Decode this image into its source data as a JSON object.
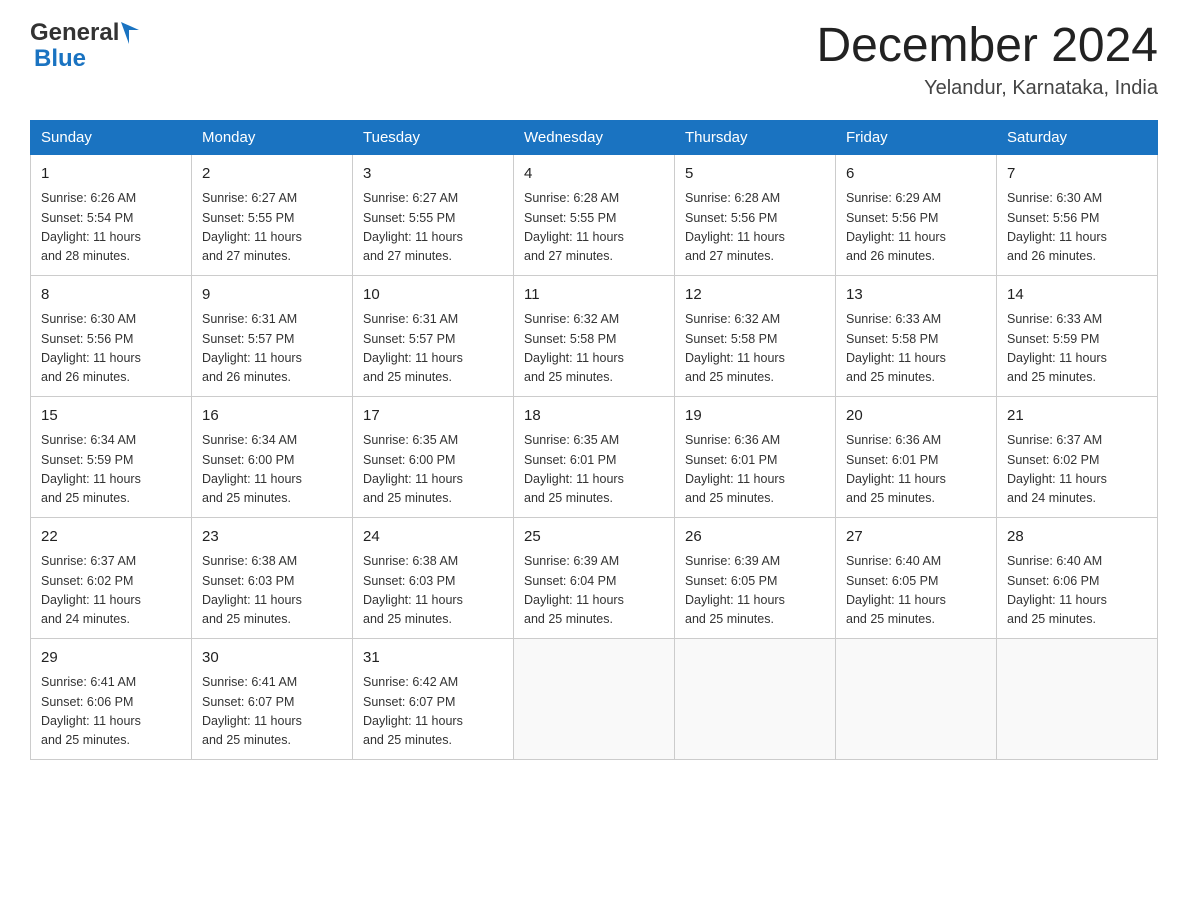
{
  "header": {
    "logo_general": "General",
    "logo_blue": "Blue",
    "title": "December 2024",
    "location": "Yelandur, Karnataka, India"
  },
  "days_of_week": [
    "Sunday",
    "Monday",
    "Tuesday",
    "Wednesday",
    "Thursday",
    "Friday",
    "Saturday"
  ],
  "weeks": [
    [
      {
        "day": "1",
        "sunrise": "6:26 AM",
        "sunset": "5:54 PM",
        "daylight": "11 hours and 28 minutes."
      },
      {
        "day": "2",
        "sunrise": "6:27 AM",
        "sunset": "5:55 PM",
        "daylight": "11 hours and 27 minutes."
      },
      {
        "day": "3",
        "sunrise": "6:27 AM",
        "sunset": "5:55 PM",
        "daylight": "11 hours and 27 minutes."
      },
      {
        "day": "4",
        "sunrise": "6:28 AM",
        "sunset": "5:55 PM",
        "daylight": "11 hours and 27 minutes."
      },
      {
        "day": "5",
        "sunrise": "6:28 AM",
        "sunset": "5:56 PM",
        "daylight": "11 hours and 27 minutes."
      },
      {
        "day": "6",
        "sunrise": "6:29 AM",
        "sunset": "5:56 PM",
        "daylight": "11 hours and 26 minutes."
      },
      {
        "day": "7",
        "sunrise": "6:30 AM",
        "sunset": "5:56 PM",
        "daylight": "11 hours and 26 minutes."
      }
    ],
    [
      {
        "day": "8",
        "sunrise": "6:30 AM",
        "sunset": "5:56 PM",
        "daylight": "11 hours and 26 minutes."
      },
      {
        "day": "9",
        "sunrise": "6:31 AM",
        "sunset": "5:57 PM",
        "daylight": "11 hours and 26 minutes."
      },
      {
        "day": "10",
        "sunrise": "6:31 AM",
        "sunset": "5:57 PM",
        "daylight": "11 hours and 25 minutes."
      },
      {
        "day": "11",
        "sunrise": "6:32 AM",
        "sunset": "5:58 PM",
        "daylight": "11 hours and 25 minutes."
      },
      {
        "day": "12",
        "sunrise": "6:32 AM",
        "sunset": "5:58 PM",
        "daylight": "11 hours and 25 minutes."
      },
      {
        "day": "13",
        "sunrise": "6:33 AM",
        "sunset": "5:58 PM",
        "daylight": "11 hours and 25 minutes."
      },
      {
        "day": "14",
        "sunrise": "6:33 AM",
        "sunset": "5:59 PM",
        "daylight": "11 hours and 25 minutes."
      }
    ],
    [
      {
        "day": "15",
        "sunrise": "6:34 AM",
        "sunset": "5:59 PM",
        "daylight": "11 hours and 25 minutes."
      },
      {
        "day": "16",
        "sunrise": "6:34 AM",
        "sunset": "6:00 PM",
        "daylight": "11 hours and 25 minutes."
      },
      {
        "day": "17",
        "sunrise": "6:35 AM",
        "sunset": "6:00 PM",
        "daylight": "11 hours and 25 minutes."
      },
      {
        "day": "18",
        "sunrise": "6:35 AM",
        "sunset": "6:01 PM",
        "daylight": "11 hours and 25 minutes."
      },
      {
        "day": "19",
        "sunrise": "6:36 AM",
        "sunset": "6:01 PM",
        "daylight": "11 hours and 25 minutes."
      },
      {
        "day": "20",
        "sunrise": "6:36 AM",
        "sunset": "6:01 PM",
        "daylight": "11 hours and 25 minutes."
      },
      {
        "day": "21",
        "sunrise": "6:37 AM",
        "sunset": "6:02 PM",
        "daylight": "11 hours and 24 minutes."
      }
    ],
    [
      {
        "day": "22",
        "sunrise": "6:37 AM",
        "sunset": "6:02 PM",
        "daylight": "11 hours and 24 minutes."
      },
      {
        "day": "23",
        "sunrise": "6:38 AM",
        "sunset": "6:03 PM",
        "daylight": "11 hours and 25 minutes."
      },
      {
        "day": "24",
        "sunrise": "6:38 AM",
        "sunset": "6:03 PM",
        "daylight": "11 hours and 25 minutes."
      },
      {
        "day": "25",
        "sunrise": "6:39 AM",
        "sunset": "6:04 PM",
        "daylight": "11 hours and 25 minutes."
      },
      {
        "day": "26",
        "sunrise": "6:39 AM",
        "sunset": "6:05 PM",
        "daylight": "11 hours and 25 minutes."
      },
      {
        "day": "27",
        "sunrise": "6:40 AM",
        "sunset": "6:05 PM",
        "daylight": "11 hours and 25 minutes."
      },
      {
        "day": "28",
        "sunrise": "6:40 AM",
        "sunset": "6:06 PM",
        "daylight": "11 hours and 25 minutes."
      }
    ],
    [
      {
        "day": "29",
        "sunrise": "6:41 AM",
        "sunset": "6:06 PM",
        "daylight": "11 hours and 25 minutes."
      },
      {
        "day": "30",
        "sunrise": "6:41 AM",
        "sunset": "6:07 PM",
        "daylight": "11 hours and 25 minutes."
      },
      {
        "day": "31",
        "sunrise": "6:42 AM",
        "sunset": "6:07 PM",
        "daylight": "11 hours and 25 minutes."
      },
      null,
      null,
      null,
      null
    ]
  ],
  "labels": {
    "sunrise": "Sunrise:",
    "sunset": "Sunset:",
    "daylight": "Daylight:"
  },
  "colors": {
    "header_bg": "#2176ae",
    "border": "#999",
    "text_dark": "#222",
    "text_blue": "#1a73c1"
  }
}
